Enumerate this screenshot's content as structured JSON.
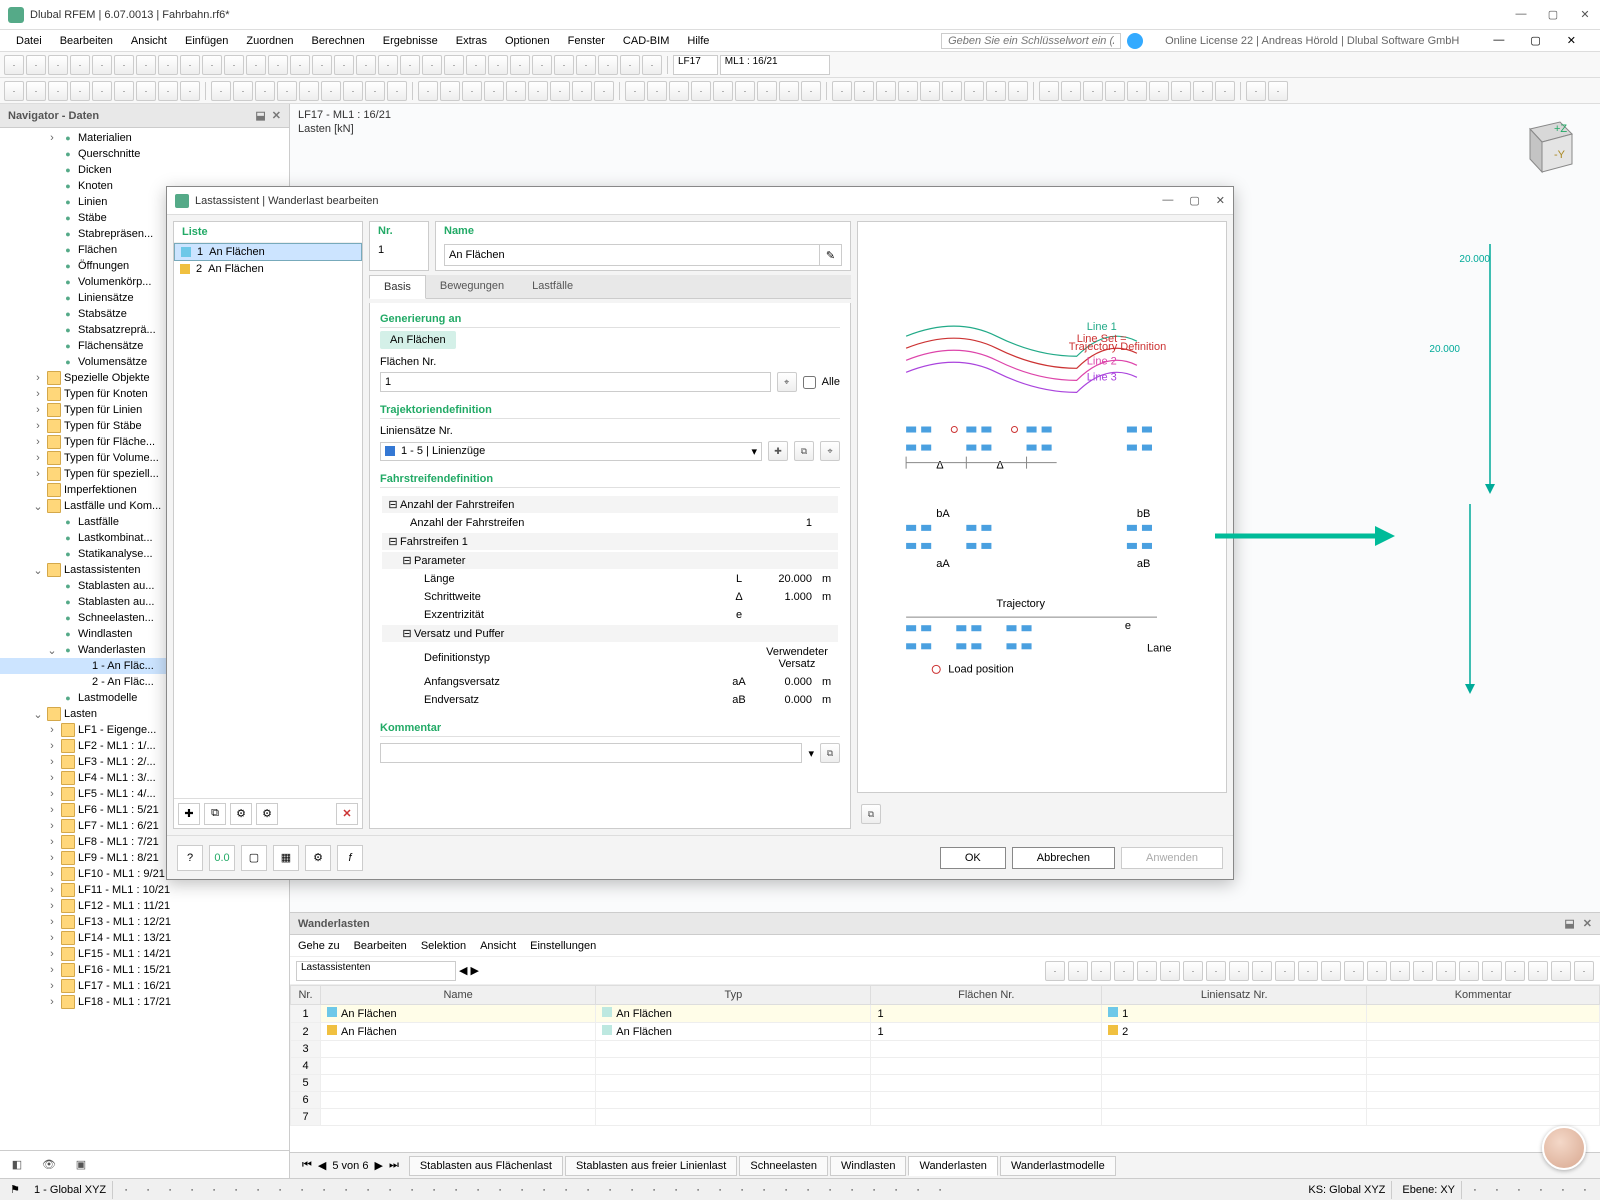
{
  "title": "Dlubal RFEM | 6.07.0013 | Fahrbahn.rf6*",
  "menu": [
    "Datei",
    "Bearbeiten",
    "Ansicht",
    "Einfügen",
    "Zuordnen",
    "Berechnen",
    "Ergebnisse",
    "Extras",
    "Optionen",
    "Fenster",
    "CAD-BIM",
    "Hilfe"
  ],
  "search_placeholder": "Geben Sie ein Schlüsselwort ein (Alt...",
  "license": "Online License 22 | Andreas Hörold | Dlubal Software GmbH",
  "toolbar_combo1": "LF17",
  "toolbar_combo2": "ML1 : 16/21",
  "navigator": {
    "title": "Navigator - Daten",
    "items": [
      {
        "l": 3,
        "t": ">",
        "ic": "node",
        "label": "Materialien"
      },
      {
        "l": 3,
        "t": "",
        "ic": "node",
        "label": "Querschnitte"
      },
      {
        "l": 3,
        "t": "",
        "ic": "node",
        "label": "Dicken"
      },
      {
        "l": 3,
        "t": "",
        "ic": "node",
        "label": "Knoten"
      },
      {
        "l": 3,
        "t": "",
        "ic": "node",
        "label": "Linien"
      },
      {
        "l": 3,
        "t": "",
        "ic": "node",
        "label": "Stäbe"
      },
      {
        "l": 3,
        "t": "",
        "ic": "node",
        "label": "Stabrepräsen..."
      },
      {
        "l": 3,
        "t": "",
        "ic": "node",
        "label": "Flächen"
      },
      {
        "l": 3,
        "t": "",
        "ic": "node",
        "label": "Öffnungen"
      },
      {
        "l": 3,
        "t": "",
        "ic": "node",
        "label": "Volumenkörp..."
      },
      {
        "l": 3,
        "t": "",
        "ic": "node",
        "label": "Liniensätze"
      },
      {
        "l": 3,
        "t": "",
        "ic": "node",
        "label": "Stabsätze"
      },
      {
        "l": 3,
        "t": "",
        "ic": "node",
        "label": "Stabsatzreprä..."
      },
      {
        "l": 3,
        "t": "",
        "ic": "node",
        "label": "Flächensätze"
      },
      {
        "l": 3,
        "t": "",
        "ic": "node",
        "label": "Volumensätze"
      },
      {
        "l": 2,
        "t": ">",
        "ic": "folder",
        "label": "Spezielle Objekte"
      },
      {
        "l": 2,
        "t": ">",
        "ic": "folder",
        "label": "Typen für Knoten"
      },
      {
        "l": 2,
        "t": ">",
        "ic": "folder",
        "label": "Typen für Linien"
      },
      {
        "l": 2,
        "t": ">",
        "ic": "folder",
        "label": "Typen für Stäbe"
      },
      {
        "l": 2,
        "t": ">",
        "ic": "folder",
        "label": "Typen für Fläche..."
      },
      {
        "l": 2,
        "t": ">",
        "ic": "folder",
        "label": "Typen für Volume..."
      },
      {
        "l": 2,
        "t": ">",
        "ic": "folder",
        "label": "Typen für speziell..."
      },
      {
        "l": 2,
        "t": "",
        "ic": "folder",
        "label": "Imperfektionen"
      },
      {
        "l": 2,
        "t": "v",
        "ic": "folder",
        "label": "Lastfälle und Kom..."
      },
      {
        "l": 3,
        "t": "",
        "ic": "node",
        "label": "Lastfälle"
      },
      {
        "l": 3,
        "t": "",
        "ic": "node",
        "label": "Lastkombinat..."
      },
      {
        "l": 3,
        "t": "",
        "ic": "node",
        "label": "Statikanalyse..."
      },
      {
        "l": 2,
        "t": "v",
        "ic": "folder",
        "label": "Lastassistenten"
      },
      {
        "l": 3,
        "t": "",
        "ic": "node",
        "label": "Stablasten au..."
      },
      {
        "l": 3,
        "t": "",
        "ic": "node",
        "label": "Stablasten au..."
      },
      {
        "l": 3,
        "t": "",
        "ic": "node",
        "label": "Schneelasten..."
      },
      {
        "l": 3,
        "t": "",
        "ic": "node",
        "label": "Windlasten"
      },
      {
        "l": 3,
        "t": "v",
        "ic": "node",
        "label": "Wanderlasten"
      },
      {
        "l": 4,
        "t": "",
        "ic": "",
        "label": "1 - An Fläc...",
        "sel": true
      },
      {
        "l": 4,
        "t": "",
        "ic": "",
        "label": "2 - An Fläc..."
      },
      {
        "l": 3,
        "t": "",
        "ic": "node",
        "label": "Lastmodelle"
      },
      {
        "l": 2,
        "t": "v",
        "ic": "folder",
        "label": "Lasten"
      },
      {
        "l": 3,
        "t": ">",
        "ic": "folder",
        "label": "LF1 - Eigenge..."
      },
      {
        "l": 3,
        "t": ">",
        "ic": "folder",
        "label": "LF2 - ML1 : 1/..."
      },
      {
        "l": 3,
        "t": ">",
        "ic": "folder",
        "label": "LF3 - ML1 : 2/..."
      },
      {
        "l": 3,
        "t": ">",
        "ic": "folder",
        "label": "LF4 - ML1 : 3/..."
      },
      {
        "l": 3,
        "t": ">",
        "ic": "folder",
        "label": "LF5 - ML1 : 4/..."
      },
      {
        "l": 3,
        "t": ">",
        "ic": "folder",
        "label": "LF6 - ML1 : 5/21"
      },
      {
        "l": 3,
        "t": ">",
        "ic": "folder",
        "label": "LF7 - ML1 : 6/21"
      },
      {
        "l": 3,
        "t": ">",
        "ic": "folder",
        "label": "LF8 - ML1 : 7/21"
      },
      {
        "l": 3,
        "t": ">",
        "ic": "folder",
        "label": "LF9 - ML1 : 8/21"
      },
      {
        "l": 3,
        "t": ">",
        "ic": "folder",
        "label": "LF10 - ML1 : 9/21"
      },
      {
        "l": 3,
        "t": ">",
        "ic": "folder",
        "label": "LF11 - ML1 : 10/21"
      },
      {
        "l": 3,
        "t": ">",
        "ic": "folder",
        "label": "LF12 - ML1 : 11/21"
      },
      {
        "l": 3,
        "t": ">",
        "ic": "folder",
        "label": "LF13 - ML1 : 12/21"
      },
      {
        "l": 3,
        "t": ">",
        "ic": "folder",
        "label": "LF14 - ML1 : 13/21"
      },
      {
        "l": 3,
        "t": ">",
        "ic": "folder",
        "label": "LF15 - ML1 : 14/21"
      },
      {
        "l": 3,
        "t": ">",
        "ic": "folder",
        "label": "LF16 - ML1 : 15/21"
      },
      {
        "l": 3,
        "t": ">",
        "ic": "folder",
        "label": "LF17 - ML1 : 16/21"
      },
      {
        "l": 3,
        "t": ">",
        "ic": "folder",
        "label": "LF18 - ML1 : 17/21"
      }
    ]
  },
  "viewport": {
    "line1": "LF17 - ML1 : 16/21",
    "line2": "Lasten [kN]",
    "dim1": "20.000",
    "dim2": "20.000"
  },
  "dialog": {
    "title": "Lastassistent | Wanderlast bearbeiten",
    "list_head": "Liste",
    "list": [
      {
        "n": "1",
        "name": "An Flächen",
        "color": "#6ec8e8",
        "sel": true
      },
      {
        "n": "2",
        "name": "An Flächen",
        "color": "#f0c040"
      }
    ],
    "nr_head": "Nr.",
    "nr": "1",
    "name_head": "Name",
    "name": "An Flächen",
    "tabs": [
      "Basis",
      "Bewegungen",
      "Lastfälle"
    ],
    "sect_gen": "Generierung an",
    "gen_val": "An Flächen",
    "surf_label": "Flächen Nr.",
    "surf_val": "1",
    "all": "Alle",
    "sect_traj": "Trajektoriendefinition",
    "ls_label": "Liniensätze Nr.",
    "ls_val": "1 - 5 | Linienzüge",
    "sect_lane": "Fahrstreifendefinition",
    "lane_count_group": "Anzahl der Fahrstreifen",
    "lane_count_label": "Anzahl der Fahrstreifen",
    "lane_count_val": "1",
    "lane1": "Fahrstreifen 1",
    "param": "Parameter",
    "rows": [
      {
        "lab": "Länge",
        "sym": "L",
        "val": "20.000",
        "unit": "m"
      },
      {
        "lab": "Schrittweite",
        "sym": "Δ",
        "val": "1.000",
        "unit": "m"
      },
      {
        "lab": "Exzentrizität",
        "sym": "e",
        "val": "",
        "unit": ""
      }
    ],
    "offset": "Versatz und Puffer",
    "rows2": [
      {
        "lab": "Definitionstyp",
        "sym": "",
        "val": "Verwendeter Versatz",
        "unit": ""
      },
      {
        "lab": "Anfangsversatz",
        "sym": "aA",
        "val": "0.000",
        "unit": "m"
      },
      {
        "lab": "Endversatz",
        "sym": "aB",
        "val": "0.000",
        "unit": "m"
      }
    ],
    "comment": "Kommentar",
    "ok": "OK",
    "cancel": "Abbrechen",
    "apply": "Anwenden"
  },
  "bottom": {
    "title": "Wanderlasten",
    "menu": [
      "Gehe zu",
      "Bearbeiten",
      "Selektion",
      "Ansicht",
      "Einstellungen"
    ],
    "combo": "Lastassistenten",
    "cols": [
      "Nr.",
      "Name",
      "Typ",
      "Flächen Nr.",
      "Liniensatz Nr.",
      "Kommentar"
    ],
    "rows": [
      {
        "n": "1",
        "name": "An Flächen",
        "typ": "An Flächen",
        "fn": "1",
        "ln": "1",
        "lc": "#6ec8e8",
        "hl": true
      },
      {
        "n": "2",
        "name": "An Flächen",
        "typ": "An Flächen",
        "fn": "1",
        "ln": "2",
        "lc": "#f0c040"
      }
    ],
    "nav": "5 von 6",
    "tabs": [
      "Stablasten aus Flächenlast",
      "Stablasten aus freier Linienlast",
      "Schneelasten",
      "Windlasten",
      "Wanderlasten",
      "Wanderlastmodelle"
    ]
  },
  "status": {
    "cs": "1 - Global XYZ",
    "ks": "KS: Global XYZ",
    "ebene": "Ebene: XY"
  }
}
